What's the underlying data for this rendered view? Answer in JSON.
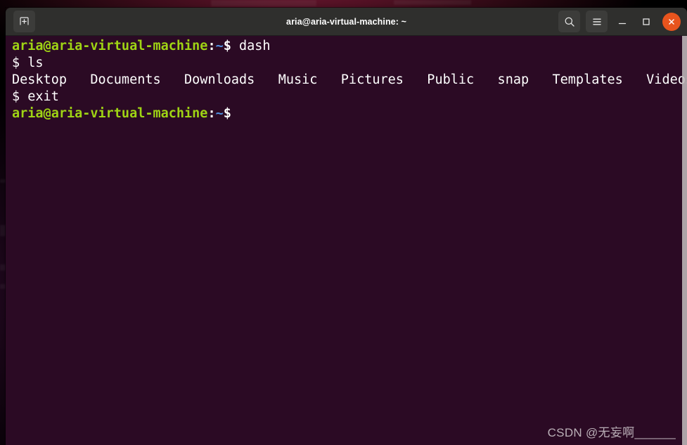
{
  "window": {
    "title": "aria@aria-virtual-machine: ~",
    "titlebar_color": "#2f2f2d",
    "terminal_bg": "#2b0a24"
  },
  "titlebar": {
    "new_tab_icon": "new-tab-icon",
    "search_icon": "search-icon",
    "menu_icon": "hamburger-menu-icon",
    "minimize_icon": "minimize-icon",
    "maximize_icon": "maximize-icon",
    "close_icon": "close-icon",
    "close_color": "#e8541d"
  },
  "terminal": {
    "colors": {
      "user_host": "#9fd414",
      "path": "#4f8fe0",
      "text": "#ffffff",
      "background": "#2b0a24"
    },
    "lines": [
      {
        "segments": [
          {
            "text": "aria@aria-virtual-machine",
            "style": "user"
          },
          {
            "text": ":",
            "style": "punct"
          },
          {
            "text": "~",
            "style": "path"
          },
          {
            "text": "$ ",
            "style": "punct"
          },
          {
            "text": "dash",
            "style": "plain"
          }
        ]
      },
      {
        "segments": [
          {
            "text": "$ ls",
            "style": "plain"
          }
        ]
      },
      {
        "segments": [
          {
            "text": "Desktop   Documents   Downloads   Music   Pictures   Public   snap   Templates   Videos",
            "style": "plain"
          }
        ]
      },
      {
        "segments": [
          {
            "text": "$ exit",
            "style": "plain"
          }
        ]
      },
      {
        "segments": [
          {
            "text": "aria@aria-virtual-machine",
            "style": "user"
          },
          {
            "text": ":",
            "style": "punct"
          },
          {
            "text": "~",
            "style": "path"
          },
          {
            "text": "$ ",
            "style": "punct"
          }
        ]
      }
    ]
  },
  "watermark": {
    "text": "CSDN @无妄啊______"
  }
}
